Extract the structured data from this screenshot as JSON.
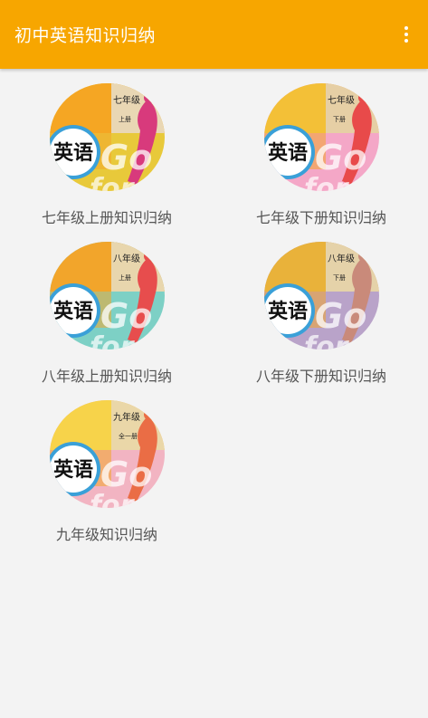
{
  "appbar": {
    "title": "初中英语知识归纳",
    "menu_icon": "more-vert-icon"
  },
  "books": [
    {
      "label": "七年级上册知识归纳",
      "grade": "七年级",
      "volume": "上册",
      "subject": "英语",
      "go_text": "Go",
      "for_text": "for",
      "colors": {
        "top": "#f5a623",
        "bottom": "#e8c93a",
        "accent": "#d83a7c",
        "spine": "#e9d7b4"
      }
    },
    {
      "label": "七年级下册知识归纳",
      "grade": "七年级",
      "volume": "下册",
      "subject": "英语",
      "go_text": "Go",
      "for_text": "for",
      "colors": {
        "top": "#f3c037",
        "bottom": "#f4a7c7",
        "accent": "#e84a4a",
        "spine": "#e6cfa5"
      }
    },
    {
      "label": "八年级上册知识归纳",
      "grade": "八年级",
      "volume": "上册",
      "subject": "英语",
      "go_text": "Go",
      "for_text": "for",
      "colors": {
        "top": "#f2a52b",
        "bottom": "#7dd0c5",
        "accent": "#e74d4d",
        "spine": "#e8d6ad"
      }
    },
    {
      "label": "八年级下册知识归纳",
      "grade": "八年级",
      "volume": "下册",
      "subject": "英语",
      "go_text": "Go",
      "for_text": "for",
      "colors": {
        "top": "#e9b23a",
        "bottom": "#b9a3c9",
        "accent": "#c98a7a",
        "spine": "#e5d2a9"
      }
    },
    {
      "label": "九年级知识归纳",
      "grade": "九年级",
      "volume": "全一册",
      "subject": "英语",
      "go_text": "Go",
      "for_text": "for",
      "colors": {
        "top": "#f7d34a",
        "bottom": "#f2b4c2",
        "accent": "#ea6d45",
        "spine": "#ead7a8"
      }
    }
  ]
}
